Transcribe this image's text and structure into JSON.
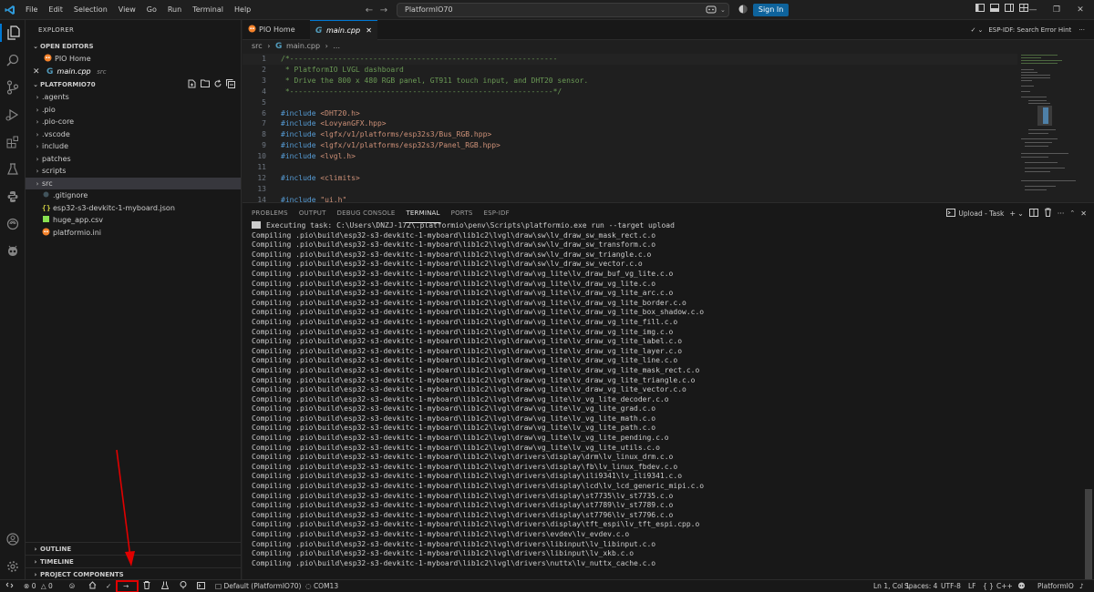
{
  "titlebar": {
    "menu": [
      "File",
      "Edit",
      "Selection",
      "View",
      "Go",
      "Run",
      "Terminal",
      "Help"
    ],
    "search": "PlatformIO70",
    "signin": "Sign In"
  },
  "sidebar": {
    "title": "EXPLORER",
    "open_editors_label": "OPEN EDITORS",
    "open_editors": [
      {
        "name": "PIO Home",
        "icon": "platformio-icon"
      },
      {
        "name": "main.cpp",
        "suffix": "src",
        "icon": "cpp-file-icon"
      }
    ],
    "project_label": "PLATFORMIO70",
    "tree": [
      {
        "name": ".agents",
        "type": "folder"
      },
      {
        "name": ".pio",
        "type": "folder"
      },
      {
        "name": ".pio-core",
        "type": "folder"
      },
      {
        "name": ".vscode",
        "type": "folder"
      },
      {
        "name": "include",
        "type": "folder"
      },
      {
        "name": "patches",
        "type": "folder"
      },
      {
        "name": "scripts",
        "type": "folder"
      },
      {
        "name": "src",
        "type": "folder",
        "selected": true
      },
      {
        "name": ".gitignore",
        "type": "file"
      },
      {
        "name": "esp32-s3-devkitc-1-myboard.json",
        "type": "file"
      },
      {
        "name": "huge_app.csv",
        "type": "file"
      },
      {
        "name": "platformio.ini",
        "type": "file"
      }
    ],
    "bottom_sections": [
      "OUTLINE",
      "TIMELINE",
      "PROJECT COMPONENTS"
    ]
  },
  "editor": {
    "tabs": [
      "PIO Home",
      "main.cpp"
    ],
    "right_label": "ESP-IDF: Search Error Hint",
    "breadcrumb": [
      "src",
      "main.cpp",
      "..."
    ],
    "lines": [
      {
        "n": "1",
        "text": "/*-------------------------------------------------------------",
        "kind": "cmt"
      },
      {
        "n": "2",
        "text": " * PlatformIO LVGL dashboard",
        "kind": "cmt"
      },
      {
        "n": "3",
        "text": " * Drive the 800 x 480 RGB panel, GT911 touch input, and DHT20 sensor.",
        "kind": "cmt"
      },
      {
        "n": "4",
        "text": " *------------------------------------------------------------*/",
        "kind": "cmt"
      },
      {
        "n": "5",
        "text": "",
        "kind": ""
      },
      {
        "n": "6",
        "text": "#include <DHT20.h>",
        "kind": "inc"
      },
      {
        "n": "7",
        "text": "#include <LovyanGFX.hpp>",
        "kind": "inc"
      },
      {
        "n": "8",
        "text": "#include <lgfx/v1/platforms/esp32s3/Bus_RGB.hpp>",
        "kind": "inc"
      },
      {
        "n": "9",
        "text": "#include <lgfx/v1/platforms/esp32s3/Panel_RGB.hpp>",
        "kind": "inc"
      },
      {
        "n": "10",
        "text": "#include <lvgl.h>",
        "kind": "inc"
      },
      {
        "n": "11",
        "text": "",
        "kind": ""
      },
      {
        "n": "12",
        "text": "#include <climits>",
        "kind": "inc"
      },
      {
        "n": "13",
        "text": "",
        "kind": ""
      },
      {
        "n": "14",
        "text": "#include \"ui.h\"",
        "kind": "inc"
      }
    ]
  },
  "panel": {
    "tabs": [
      "PROBLEMS",
      "OUTPUT",
      "DEBUG CONSOLE",
      "TERMINAL",
      "PORTS",
      "ESP-IDF"
    ],
    "active_tab": "TERMINAL",
    "task_label": "Upload - Task",
    "task_line": "Executing task: C:\\Users\\DNZJ-172\\.platformio\\penv\\Scripts\\platformio.exe run --target upload",
    "lines": [
      "Compiling .pio\\build\\esp32-s3-devkitc-1-myboard\\lib1c2\\lvgl\\draw\\sw\\lv_draw_sw_mask_rect.c.o",
      "Compiling .pio\\build\\esp32-s3-devkitc-1-myboard\\lib1c2\\lvgl\\draw\\sw\\lv_draw_sw_transform.c.o",
      "Compiling .pio\\build\\esp32-s3-devkitc-1-myboard\\lib1c2\\lvgl\\draw\\sw\\lv_draw_sw_triangle.c.o",
      "Compiling .pio\\build\\esp32-s3-devkitc-1-myboard\\lib1c2\\lvgl\\draw\\sw\\lv_draw_sw_vector.c.o",
      "Compiling .pio\\build\\esp32-s3-devkitc-1-myboard\\lib1c2\\lvgl\\draw\\vg_lite\\lv_draw_buf_vg_lite.c.o",
      "Compiling .pio\\build\\esp32-s3-devkitc-1-myboard\\lib1c2\\lvgl\\draw\\vg_lite\\lv_draw_vg_lite.c.o",
      "Compiling .pio\\build\\esp32-s3-devkitc-1-myboard\\lib1c2\\lvgl\\draw\\vg_lite\\lv_draw_vg_lite_arc.c.o",
      "Compiling .pio\\build\\esp32-s3-devkitc-1-myboard\\lib1c2\\lvgl\\draw\\vg_lite\\lv_draw_vg_lite_border.c.o",
      "Compiling .pio\\build\\esp32-s3-devkitc-1-myboard\\lib1c2\\lvgl\\draw\\vg_lite\\lv_draw_vg_lite_box_shadow.c.o",
      "Compiling .pio\\build\\esp32-s3-devkitc-1-myboard\\lib1c2\\lvgl\\draw\\vg_lite\\lv_draw_vg_lite_fill.c.o",
      "Compiling .pio\\build\\esp32-s3-devkitc-1-myboard\\lib1c2\\lvgl\\draw\\vg_lite\\lv_draw_vg_lite_img.c.o",
      "Compiling .pio\\build\\esp32-s3-devkitc-1-myboard\\lib1c2\\lvgl\\draw\\vg_lite\\lv_draw_vg_lite_label.c.o",
      "Compiling .pio\\build\\esp32-s3-devkitc-1-myboard\\lib1c2\\lvgl\\draw\\vg_lite\\lv_draw_vg_lite_layer.c.o",
      "Compiling .pio\\build\\esp32-s3-devkitc-1-myboard\\lib1c2\\lvgl\\draw\\vg_lite\\lv_draw_vg_lite_line.c.o",
      "Compiling .pio\\build\\esp32-s3-devkitc-1-myboard\\lib1c2\\lvgl\\draw\\vg_lite\\lv_draw_vg_lite_mask_rect.c.o",
      "Compiling .pio\\build\\esp32-s3-devkitc-1-myboard\\lib1c2\\lvgl\\draw\\vg_lite\\lv_draw_vg_lite_triangle.c.o",
      "Compiling .pio\\build\\esp32-s3-devkitc-1-myboard\\lib1c2\\lvgl\\draw\\vg_lite\\lv_draw_vg_lite_vector.c.o",
      "Compiling .pio\\build\\esp32-s3-devkitc-1-myboard\\lib1c2\\lvgl\\draw\\vg_lite\\lv_vg_lite_decoder.c.o",
      "Compiling .pio\\build\\esp32-s3-devkitc-1-myboard\\lib1c2\\lvgl\\draw\\vg_lite\\lv_vg_lite_grad.c.o",
      "Compiling .pio\\build\\esp32-s3-devkitc-1-myboard\\lib1c2\\lvgl\\draw\\vg_lite\\lv_vg_lite_math.c.o",
      "Compiling .pio\\build\\esp32-s3-devkitc-1-myboard\\lib1c2\\lvgl\\draw\\vg_lite\\lv_vg_lite_path.c.o",
      "Compiling .pio\\build\\esp32-s3-devkitc-1-myboard\\lib1c2\\lvgl\\draw\\vg_lite\\lv_vg_lite_pending.c.o",
      "Compiling .pio\\build\\esp32-s3-devkitc-1-myboard\\lib1c2\\lvgl\\draw\\vg_lite\\lv_vg_lite_utils.c.o",
      "Compiling .pio\\build\\esp32-s3-devkitc-1-myboard\\lib1c2\\lvgl\\drivers\\display\\drm\\lv_linux_drm.c.o",
      "Compiling .pio\\build\\esp32-s3-devkitc-1-myboard\\lib1c2\\lvgl\\drivers\\display\\fb\\lv_linux_fbdev.c.o",
      "Compiling .pio\\build\\esp32-s3-devkitc-1-myboard\\lib1c2\\lvgl\\drivers\\display\\ili9341\\lv_ili9341.c.o",
      "Compiling .pio\\build\\esp32-s3-devkitc-1-myboard\\lib1c2\\lvgl\\drivers\\display\\lcd\\lv_lcd_generic_mipi.c.o",
      "Compiling .pio\\build\\esp32-s3-devkitc-1-myboard\\lib1c2\\lvgl\\drivers\\display\\st7735\\lv_st7735.c.o",
      "Compiling .pio\\build\\esp32-s3-devkitc-1-myboard\\lib1c2\\lvgl\\drivers\\display\\st7789\\lv_st7789.c.o",
      "Compiling .pio\\build\\esp32-s3-devkitc-1-myboard\\lib1c2\\lvgl\\drivers\\display\\st7796\\lv_st7796.c.o",
      "Compiling .pio\\build\\esp32-s3-devkitc-1-myboard\\lib1c2\\lvgl\\drivers\\display\\tft_espi\\lv_tft_espi.cpp.o",
      "Compiling .pio\\build\\esp32-s3-devkitc-1-myboard\\lib1c2\\lvgl\\drivers\\evdev\\lv_evdev.c.o",
      "Compiling .pio\\build\\esp32-s3-devkitc-1-myboard\\lib1c2\\lvgl\\drivers\\libinput\\lv_libinput.c.o",
      "Compiling .pio\\build\\esp32-s3-devkitc-1-myboard\\lib1c2\\lvgl\\drivers\\libinput\\lv_xkb.c.o",
      "Compiling .pio\\build\\esp32-s3-devkitc-1-myboard\\lib1c2\\lvgl\\drivers\\nuttx\\lv_nuttx_cache.c.o"
    ]
  },
  "status": {
    "errors": "0",
    "warnings": "0",
    "env": "Default (PlatformIO70)",
    "port": "COM13",
    "cursor": "Ln 1, Col 1",
    "spaces": "Spaces: 4",
    "encoding": "UTF-8",
    "eol": "LF",
    "lang": "C++",
    "platform": "PlatformIO"
  },
  "colors": {
    "accent": "#0078d4",
    "signin": "#0e639c",
    "highlight": "#e00000"
  }
}
